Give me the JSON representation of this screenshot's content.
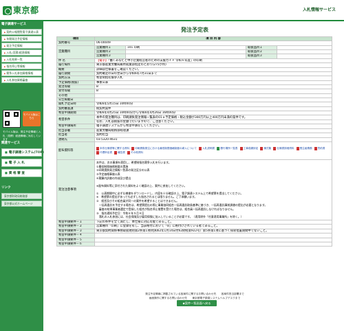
{
  "header": {
    "logo_text": "東京都",
    "service": "入札情報サービス"
  },
  "side": {
    "section1": "電子調達サービス",
    "items": [
      "契約公報閲覧電子調達公表",
      "年間発注予定情報",
      "発注予定情報",
      "入札(見積)経過情報",
      "入札結果一覧",
      "指名停止等情報",
      "競争入札参加資格情報",
      "入札参加資格審査"
    ],
    "qr_btn": "モバイル版はこちら",
    "mobile_text": "モバイル版は、発注予定情報と入札（見積）経過情報に対応しています",
    "section2": "関連サービス",
    "big": [
      "電子調達システム(TOP)",
      "電 子 入 札",
      "資 格 審 査"
    ],
    "section3": "リンク",
    "links": [
      "東京都財政局総務部",
      "東京都公式ホームページ"
    ]
  },
  "title": "発注予定表",
  "col_item": "項目",
  "col_content": "項 目 内 容",
  "rows": {
    "keiyaku_no_l": "契約番号",
    "keiyaku_no": "06-00049",
    "eigyo_l": "営業種目",
    "eigyo": [
      [
        "営業種目１",
        "101 印刷",
        "取扱品目１",
        ""
      ],
      [
        "営業種目２",
        "",
        "取扱品目２",
        ""
      ],
      [
        "営業種目３",
        "",
        "取扱品目３",
        ""
      ]
    ],
    "kenmei_l": "件 名",
    "kenmei_tag": "【電子】",
    "kenmei": "「働くあなたと中小企業経営者のための支援ガイド 令和６年度」の印刷",
    "kikan_l": "履行場所",
    "kikan": "東京都産業労働局雇用就業部指定のとおり(275か所)",
    "gaiyo_l": "概要",
    "gaiyo": "詳細は仕様書をご確認ください。",
    "rikou_l": "履行期間",
    "rikou": "契約確定の日の翌日から令和6年7月31日まで",
    "hoho_l": "契約方法",
    "hoho": "希望制指名競争入札",
    "yotei_l": "予定価格(税抜)",
    "yotei": "事後公表",
    "hassho_l": "発注等級",
    "hassho": "B",
    "juchu_l": "受付等級",
    "juchu": "B",
    "sonota_l": "その他",
    "sonota": "",
    "koukoku_l": "公告掲載日",
    "koukoku": "",
    "kaisatsu_l": "開札予定日時",
    "kaisatsu": "令和6年5月15日 10時00分",
    "shikaku_l": "契約審査課",
    "shikaku": "統契約案件",
    "kikan2_l": "希望申請期間",
    "kikan2": "令和6年4月25日 10時00分から令和6年4月26日 16時00分",
    "youken_l": "希望条件",
    "youken": "本件の発注種目は、印刷請負発注情報一覧表の01ａ予定価格・税込金額が300万円以上400万円未満の案件です。",
    "youken2": "なお、入札は税抜の金額で行いますので、ご注意ください。",
    "system_l": "希望申請場所",
    "system": "電子調達システムから希望申請をしてください。",
    "tantou_l": "担当部署",
    "tantou": "産業労働局総務部経理課",
    "tantousha_l": "担当者",
    "tantousha": "契約担当",
    "renraku_l": "連絡先",
    "renraku": "03-5320-4631",
    "shiryo_l": "配布資料等",
    "attach": [
      "本件仕様書等に関する資料",
      "印刷請負発注における最低制限価格制度の導入について",
      "入札説明書",
      "履行場所一覧表",
      "工事成績評定",
      "様式集",
      "仕様書詳細資料",
      "受注者責務",
      "誓約書",
      "代理申出書",
      "報告書",
      "その他資料"
    ],
    "jiko_l": "発注注意事項",
    "jiko": [
      "本件は、次の事項を適用し、希望制指名競争入札を行います。",
      "①最低制限価格制度の実施",
      "②印刷請負発注情報一覧表の発注区分の公表",
      "③予定価格事後公表",
      "④積算内訳書の作成及び提出",
      "",
      "※配布資料等に添付された資料をよく確認の上、案件に参加してください。",
      "",
      "①　公表期間中に必ず仕様書をダウンロードし、内容を十分確認の上、電子調達システム上で希望票を提出してください。",
      "※　希望票の提出があっても必ずしも指名されるとは限りません。ご了承願います。",
      "②　経営及びその組合員が同一の案件を希望することはできません。",
      "　一括再委託を予定する場合は、希望票提出の際に事業協同組合一括再委託取扱基準に基づき、一括再委託事前調書の提出が必要となります。",
      "　審査の結果事業者選定で登録した組合が指名停止措置を受けた場合は、組合員一括再委託しなければなりません。",
      "③　指名通知予定日：令和６年５月８日",
      "　落札の入札参加には、社会保険及び雇用保険に加入していることが必要です。（適用除外「任意適用事業所」を除く。）"
    ],
    "j1_l": "希望申請要件－１",
    "j1": "下記の条件を全て満たし、本仕様に対応可能であること。",
    "j2_l": "希望申請要件－２",
    "j2": "営業種目「印刷」に登録を有し、当該格付において「B」に格付けされている者であること。",
    "j3_l": "希望申請要件－３",
    "j3": "東京都契約関係事務取扱規則第2条第1項(昭和62年1月14日付62財経第922号）第5条第1項に基づく排除措置期間中でないこと。",
    "j4_l": "希望申請要件－４",
    "j4": "",
    "j5_l": "希望申請要件－５",
    "j5": "",
    "j6_l": "希望申請要件－６",
    "j6": ""
  },
  "back_btn": "◆案件一覧画面へ戻る",
  "footer": [
    "発注予定情報に掲載されている各案件に関するお問い合わせ先　　各案件担当部署まで",
    "画面操作に関するお問い合わせ先　　東京都電子調達システムヘルプデスクまで"
  ]
}
